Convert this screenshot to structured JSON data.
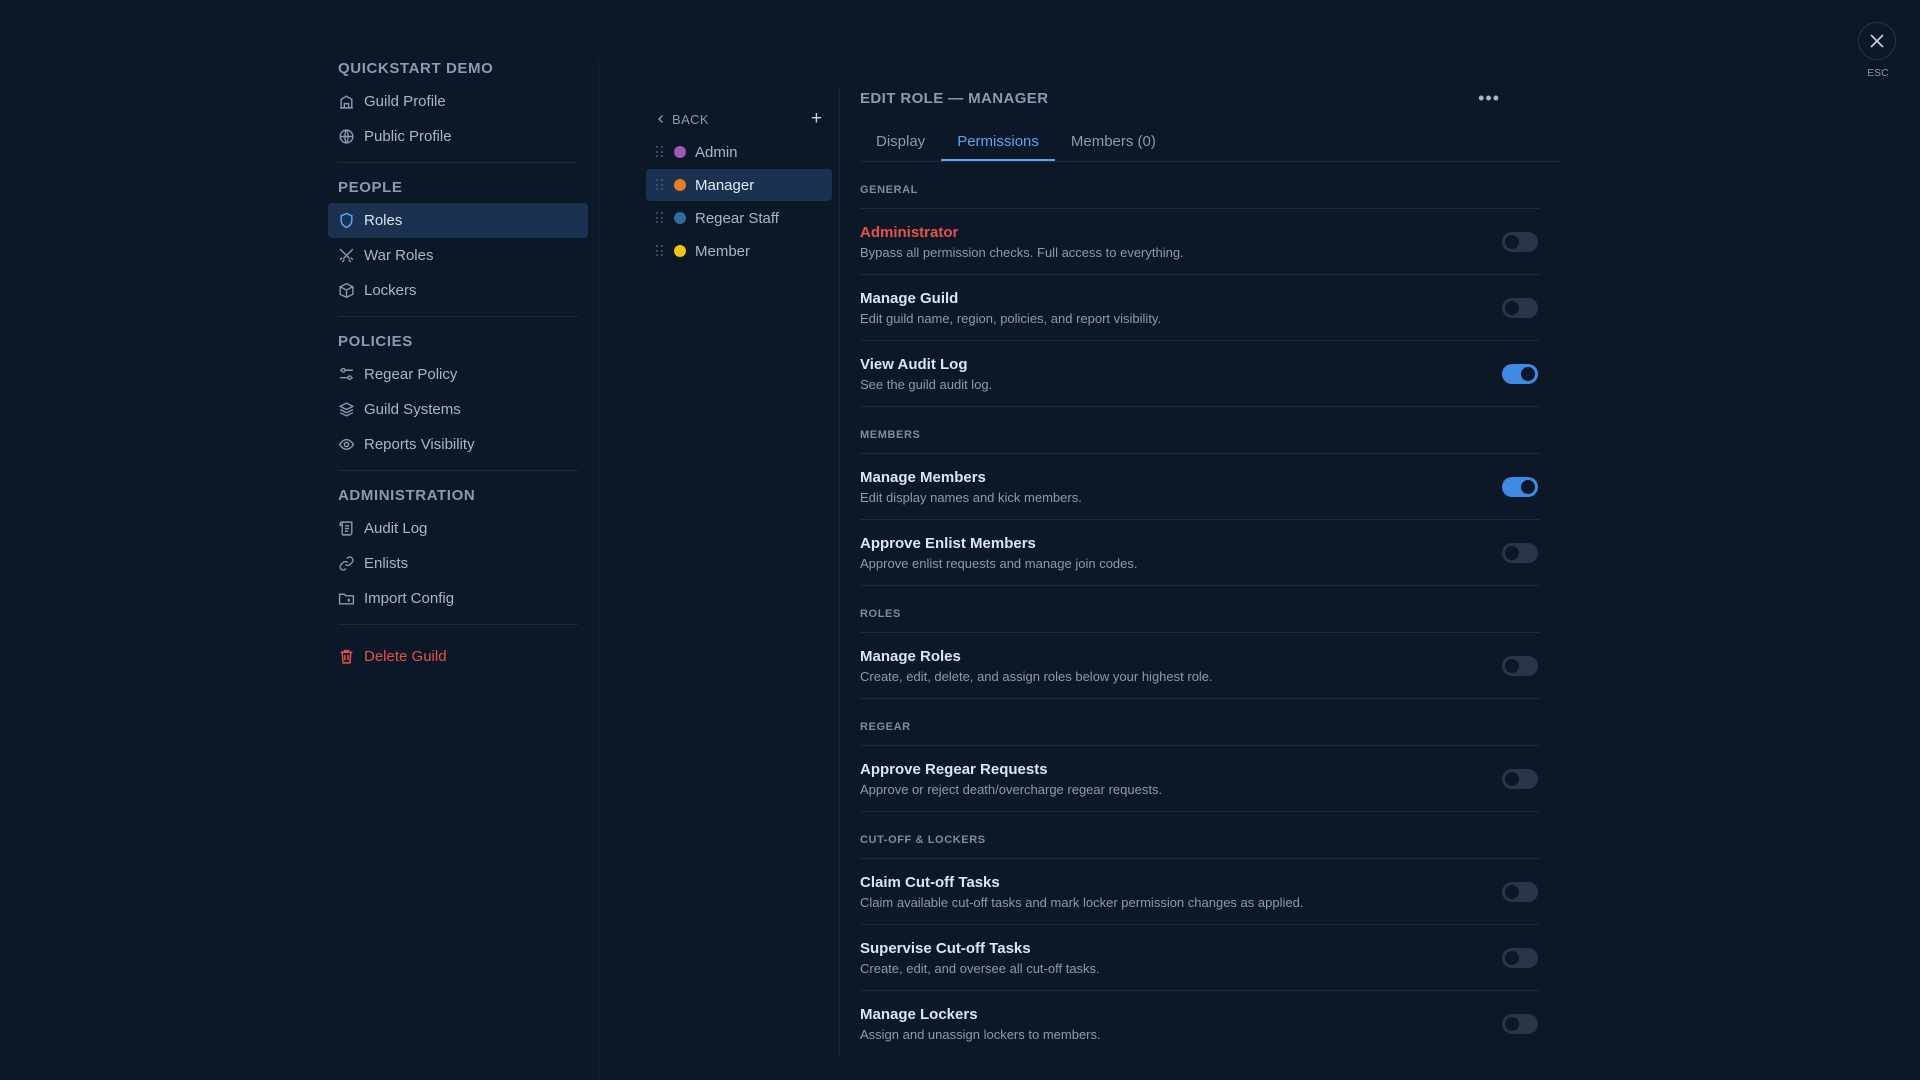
{
  "sidebar": {
    "guild_name": "QUICKSTART DEMO",
    "guild_items": [
      {
        "label": "Guild Profile",
        "icon": "building-icon"
      },
      {
        "label": "Public Profile",
        "icon": "globe-icon"
      }
    ],
    "people_title": "PEOPLE",
    "people_items": [
      {
        "label": "Roles",
        "icon": "shield-icon"
      },
      {
        "label": "War Roles",
        "icon": "crossed-swords-icon"
      },
      {
        "label": "Lockers",
        "icon": "box-icon"
      }
    ],
    "policies_title": "POLICIES",
    "policies_items": [
      {
        "label": "Regear Policy",
        "icon": "sliders-icon"
      },
      {
        "label": "Guild Systems",
        "icon": "layers-icon"
      },
      {
        "label": "Reports Visibility",
        "icon": "eye-icon"
      }
    ],
    "admin_title": "ADMINISTRATION",
    "admin_items": [
      {
        "label": "Audit Log",
        "icon": "scroll-icon"
      },
      {
        "label": "Enlists",
        "icon": "link-icon"
      },
      {
        "label": "Import Config",
        "icon": "folder-import-icon"
      }
    ],
    "delete_label": "Delete Guild"
  },
  "roles": {
    "back_label": "BACK",
    "items": [
      {
        "name": "Admin",
        "color": "#9b59b6"
      },
      {
        "name": "Manager",
        "color": "#e67e22"
      },
      {
        "name": "Regear Staff",
        "color": "#2e6da4"
      },
      {
        "name": "Member",
        "color": "#f1c40f"
      }
    ]
  },
  "editor": {
    "title": "EDIT ROLE — MANAGER",
    "tabs": [
      "Display",
      "Permissions",
      "Members (0)"
    ],
    "groups": [
      {
        "title": "GENERAL",
        "perms": [
          {
            "name": "Administrator",
            "desc": "Bypass all permission checks. Full access to everything.",
            "enabled": false
          },
          {
            "name": "Manage Guild",
            "desc": "Edit guild name, region, policies, and report visibility.",
            "enabled": false
          },
          {
            "name": "View Audit Log",
            "desc": "See the guild audit log.",
            "enabled": true
          }
        ]
      },
      {
        "title": "MEMBERS",
        "perms": [
          {
            "name": "Manage Members",
            "desc": "Edit display names and kick members.",
            "enabled": true
          },
          {
            "name": "Approve Enlist Members",
            "desc": "Approve enlist requests and manage join codes.",
            "enabled": false
          }
        ]
      },
      {
        "title": "ROLES",
        "perms": [
          {
            "name": "Manage Roles",
            "desc": "Create, edit, delete, and assign roles below your highest role.",
            "enabled": false
          }
        ]
      },
      {
        "title": "REGEAR",
        "perms": [
          {
            "name": "Approve Regear Requests",
            "desc": "Approve or reject death/overcharge regear requests.",
            "enabled": false
          }
        ]
      },
      {
        "title": "CUT-OFF & LOCKERS",
        "perms": [
          {
            "name": "Claim Cut-off Tasks",
            "desc": "Claim available cut-off tasks and mark locker permission changes as applied.",
            "enabled": false
          },
          {
            "name": "Supervise Cut-off Tasks",
            "desc": "Create, edit, and oversee all cut-off tasks.",
            "enabled": false
          },
          {
            "name": "Manage Lockers",
            "desc": "Assign and unassign lockers to members.",
            "enabled": false
          }
        ]
      }
    ]
  },
  "close": {
    "esc_label": "ESC"
  },
  "colors": {
    "accent": "#3f8ae2",
    "danger": "#e7514a",
    "background": "#0c1727"
  }
}
